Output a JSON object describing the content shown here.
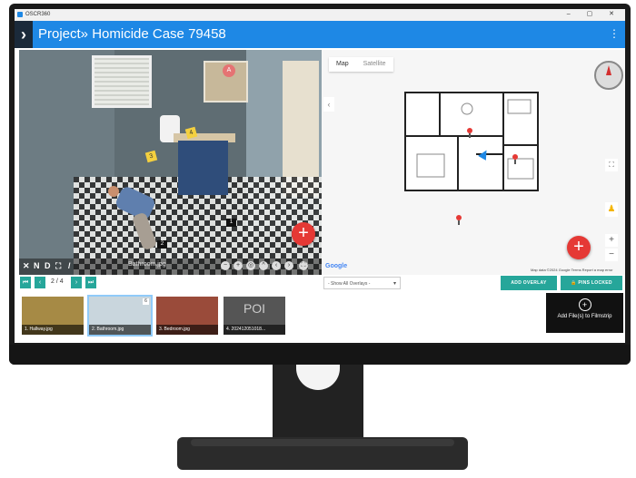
{
  "window": {
    "app_title": "OSCR360",
    "controls": "–  ▢  ✕"
  },
  "header": {
    "chevron": "›",
    "title": "Project» Homicide Case 79458",
    "menu": "⋮"
  },
  "viewer": {
    "filename": "Bathroom.jpg",
    "markers": [
      "4",
      "3"
    ],
    "tags": [
      "1",
      "2"
    ],
    "pin": "A",
    "tools": [
      "✕",
      "N",
      "D",
      "⛶",
      "/"
    ]
  },
  "map": {
    "tabs": {
      "map": "Map",
      "satellite": "Satellite"
    },
    "collapse": "‹",
    "google": "Google",
    "footer": "Map data ©2024 Google   Terms   Report a map error"
  },
  "pager": {
    "counter": "2 / 4"
  },
  "overlays": {
    "placeholder": "- Show All Overlays -"
  },
  "actions": {
    "add_overlay": "ADD OVERLAY",
    "pins_locked": "🔒 PINS LOCKED"
  },
  "filmstrip": {
    "items": [
      {
        "label": "1. Hallway.jpg"
      },
      {
        "label": "2. Bathroom.jpg",
        "badge": "6"
      },
      {
        "label": "3. Bedroom.jpg"
      },
      {
        "label": "4. 202412051018...",
        "poi": "POI"
      }
    ],
    "add_label": "Add File(s) to Filmstrip"
  },
  "colors": {
    "brand": "#1e88e5",
    "accent": "#26a69a",
    "fab": "#e53935"
  }
}
